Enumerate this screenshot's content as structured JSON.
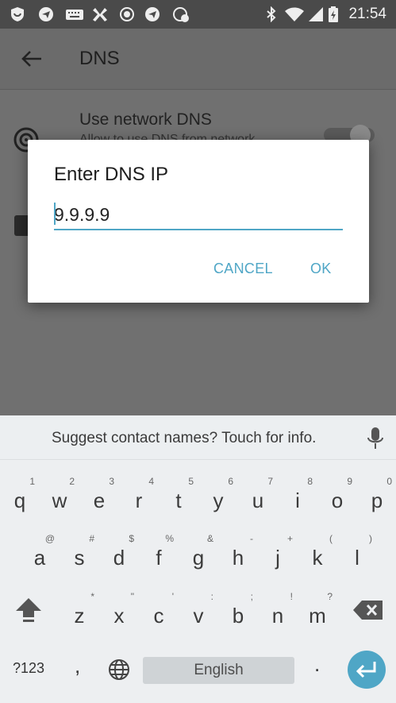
{
  "status_bar": {
    "time": "21:54",
    "icons": [
      "shield-icon",
      "telegram-icon",
      "keyboard-icon",
      "android-icon",
      "record-icon",
      "telegram-icon",
      "pinwheel-icon",
      "bluetooth-icon",
      "wifi-icon",
      "signal-icon",
      "battery-icon"
    ]
  },
  "app_bar": {
    "title": "DNS"
  },
  "settings": {
    "use_network_dns_title": "Use network DNS",
    "use_network_dns_subtitle": "Allow to use DNS from network"
  },
  "dialog": {
    "title": "Enter DNS IP",
    "input_value": "9.9.9.9",
    "cancel_label": "CANCEL",
    "ok_label": "OK"
  },
  "keyboard": {
    "suggestion": "Suggest contact names? Touch for info.",
    "row1": [
      {
        "ch": "q",
        "hint": "1"
      },
      {
        "ch": "w",
        "hint": "2"
      },
      {
        "ch": "e",
        "hint": "3"
      },
      {
        "ch": "r",
        "hint": "4"
      },
      {
        "ch": "t",
        "hint": "5"
      },
      {
        "ch": "y",
        "hint": "6"
      },
      {
        "ch": "u",
        "hint": "7"
      },
      {
        "ch": "i",
        "hint": "8"
      },
      {
        "ch": "o",
        "hint": "9"
      },
      {
        "ch": "p",
        "hint": "0"
      }
    ],
    "row2": [
      {
        "ch": "a",
        "hint": "@"
      },
      {
        "ch": "s",
        "hint": "#"
      },
      {
        "ch": "d",
        "hint": "$"
      },
      {
        "ch": "f",
        "hint": "%"
      },
      {
        "ch": "g",
        "hint": "&"
      },
      {
        "ch": "h",
        "hint": "-"
      },
      {
        "ch": "j",
        "hint": "+"
      },
      {
        "ch": "k",
        "hint": "("
      },
      {
        "ch": "l",
        "hint": ")"
      }
    ],
    "row3": [
      {
        "ch": "z",
        "hint": "*"
      },
      {
        "ch": "x",
        "hint": "\""
      },
      {
        "ch": "c",
        "hint": "'"
      },
      {
        "ch": "v",
        "hint": ":"
      },
      {
        "ch": "b",
        "hint": ";"
      },
      {
        "ch": "n",
        "hint": "!"
      },
      {
        "ch": "m",
        "hint": "?"
      }
    ],
    "symbols_label": "?123",
    "comma": ",",
    "space_label": "English",
    "period": "."
  },
  "colors": {
    "accent": "#4fa6c6",
    "scrim": "#6e6e6e"
  }
}
